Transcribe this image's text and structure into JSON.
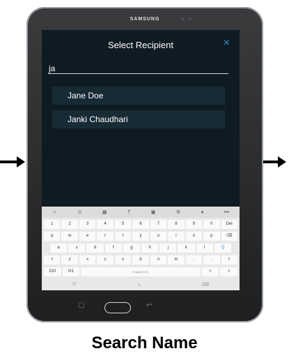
{
  "device": {
    "brand": "SAMSUNG"
  },
  "dialog": {
    "title": "Select Recipient",
    "close_icon": "×",
    "search_value": "ja",
    "results": [
      "Jane Doe",
      "Janki Chaudhari"
    ]
  },
  "keyboard": {
    "top_icons": [
      "☺",
      "⊙",
      "▦",
      "T",
      "▣",
      "⚙",
      "♦",
      "•••"
    ],
    "row1": [
      "1",
      "2",
      "3",
      "4",
      "5",
      "6",
      "7",
      "8",
      "9",
      "0",
      "Del"
    ],
    "row2": [
      "q",
      "w",
      "e",
      "r",
      "t",
      "y",
      "u",
      "i",
      "o",
      "p",
      "⌫"
    ],
    "row3": [
      "a",
      "s",
      "d",
      "f",
      "g",
      "h",
      "j",
      "k",
      "l",
      "Q"
    ],
    "row4": [
      "⇧",
      "z",
      "x",
      "c",
      "v",
      "b",
      "n",
      "m",
      ",",
      ".",
      "⇧"
    ],
    "row5": [
      "Ctrl",
      "!#1",
      "English (US)",
      "<",
      ">"
    ],
    "bottom": [
      "III",
      "∨",
      "⌨"
    ]
  },
  "caption": "Search Name",
  "colors": {
    "screen_bg": "#0f1b23",
    "result_bg": "#172b35",
    "accent": "#2f9ad8"
  }
}
